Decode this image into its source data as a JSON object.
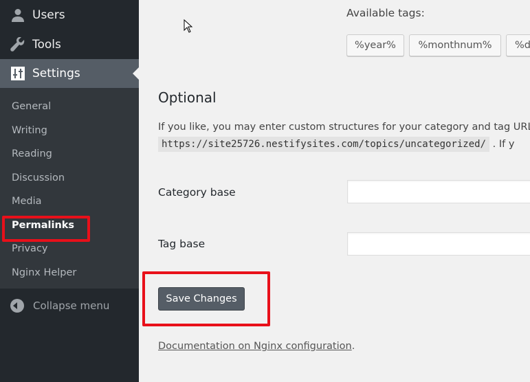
{
  "sidebar": {
    "menu": [
      {
        "label": "Users",
        "icon": "users-icon"
      },
      {
        "label": "Tools",
        "icon": "wrench-icon"
      },
      {
        "label": "Settings",
        "icon": "settings-sliders-icon",
        "active": true
      }
    ],
    "submenu": [
      "General",
      "Writing",
      "Reading",
      "Discussion",
      "Media",
      "Permalinks",
      "Privacy",
      "Nginx Helper"
    ],
    "current_submenu": "Permalinks",
    "collapse_label": "Collapse menu"
  },
  "main": {
    "available_tags_label": "Available tags:",
    "tags": [
      "%year%",
      "%monthnum%",
      "%day%"
    ],
    "optional_heading": "Optional",
    "optional_desc": "If you like, you may enter custom structures for your category and tag URLs",
    "example_url": "https://site25726.nestifysites.com/topics/uncategorized/",
    "example_suffix": ". If y",
    "category_base_label": "Category base",
    "category_base_value": "",
    "tag_base_label": "Tag base",
    "tag_base_value": "",
    "save_button": "Save Changes",
    "doc_link": "Documentation on Nginx configuration",
    "doc_suffix": "."
  },
  "colors": {
    "highlight_box": "#e8101a",
    "sidebar_bg": "#23282d",
    "active_menu": "#555d66",
    "button": "#555d66"
  }
}
